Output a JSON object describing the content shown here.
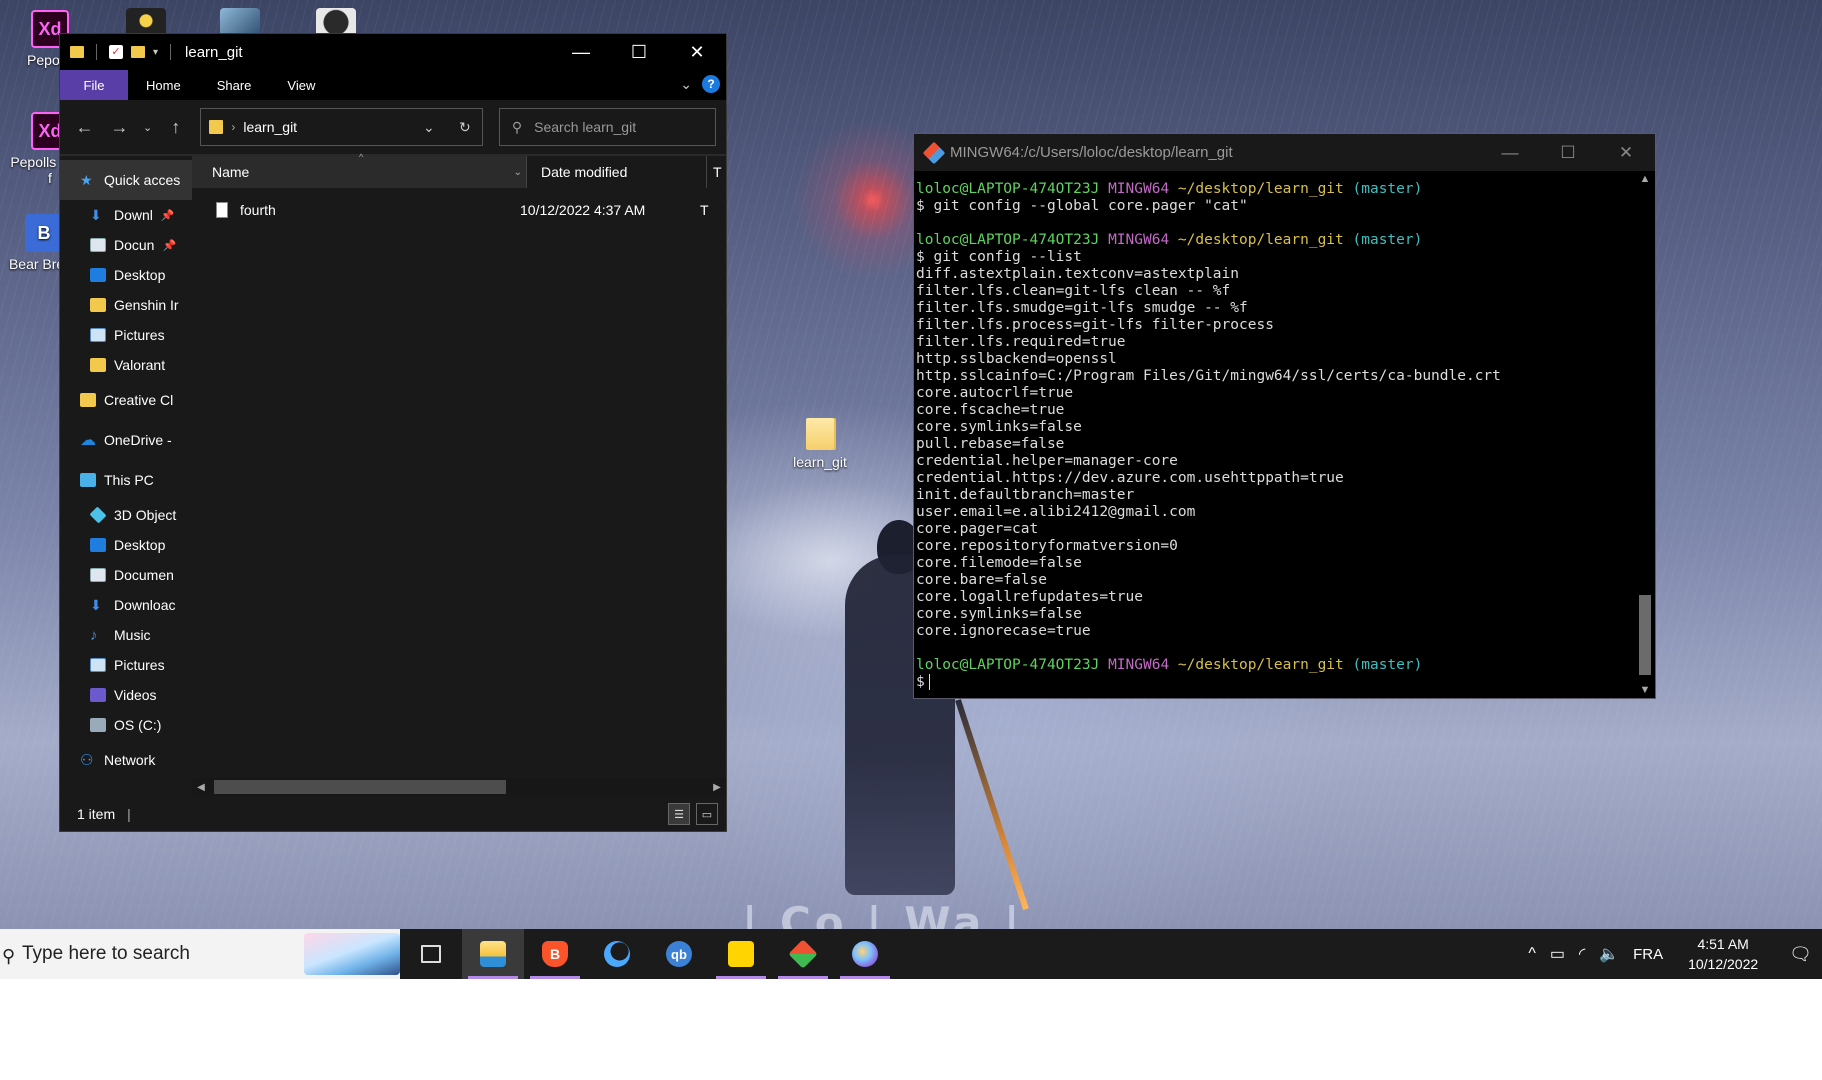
{
  "desktop": {
    "icons": [
      {
        "label": "Pepolls",
        "glyph": "Xd"
      },
      {
        "label": "Pepolls User f",
        "glyph": "Xd"
      },
      {
        "label": "Bear Break",
        "glyph": "B"
      }
    ],
    "folder_label": "learn_git",
    "wallpaper_text": "| Co | Wa |"
  },
  "explorer": {
    "title": "learn_git",
    "ribbon_tabs": [
      "File",
      "Home",
      "Share",
      "View"
    ],
    "address_path": "learn_git",
    "search_placeholder": "Search learn_git",
    "sidebar": [
      {
        "label": "Quick acces",
        "icon": "star-icon",
        "level": "top"
      },
      {
        "label": "Downl",
        "icon": "download-icon",
        "pinned": true
      },
      {
        "label": "Docun",
        "icon": "document-icon",
        "pinned": true
      },
      {
        "label": "Desktop",
        "icon": "desktop-icon"
      },
      {
        "label": "Genshin Ir",
        "icon": "folder-icon"
      },
      {
        "label": "Pictures",
        "icon": "pictures-icon"
      },
      {
        "label": "Valorant",
        "icon": "folder-icon"
      },
      {
        "label": "Creative Cl",
        "icon": "creative-cloud-icon",
        "level": "top"
      },
      {
        "label": "OneDrive -",
        "icon": "onedrive-icon",
        "level": "top"
      },
      {
        "label": "This PC",
        "icon": "this-pc-icon",
        "level": "top"
      },
      {
        "label": "3D Object",
        "icon": "3d-objects-icon"
      },
      {
        "label": "Desktop",
        "icon": "desktop-icon"
      },
      {
        "label": "Documen",
        "icon": "document-icon"
      },
      {
        "label": "Downloac",
        "icon": "download-icon"
      },
      {
        "label": "Music",
        "icon": "music-icon"
      },
      {
        "label": "Pictures",
        "icon": "pictures-icon"
      },
      {
        "label": "Videos",
        "icon": "videos-icon"
      },
      {
        "label": "OS (C:)",
        "icon": "drive-icon"
      },
      {
        "label": "Network",
        "icon": "network-icon",
        "level": "top"
      }
    ],
    "columns": {
      "name": "Name",
      "date": "Date modified",
      "type": "T"
    },
    "files": [
      {
        "name": "fourth",
        "date": "10/12/2022 4:37 AM",
        "type": "T"
      }
    ],
    "status": "1 item"
  },
  "terminal": {
    "title": "MINGW64:/c/Users/loloc/desktop/learn_git",
    "prompt": {
      "user": "loloc@LAPTOP-474OT23J",
      "system": "MINGW64",
      "path": "~/desktop/learn_git",
      "branch": "(master)"
    },
    "cmd1": "$ git config --global core.pager \"cat\"",
    "cmd2": "$ git config --list",
    "output": "diff.astextplain.textconv=astextplain\nfilter.lfs.clean=git-lfs clean -- %f\nfilter.lfs.smudge=git-lfs smudge -- %f\nfilter.lfs.process=git-lfs filter-process\nfilter.lfs.required=true\nhttp.sslbackend=openssl\nhttp.sslcainfo=C:/Program Files/Git/mingw64/ssl/certs/ca-bundle.crt\ncore.autocrlf=true\ncore.fscache=true\ncore.symlinks=false\npull.rebase=false\ncredential.helper=manager-core\ncredential.https://dev.azure.com.usehttppath=true\ninit.defaultbranch=master\nuser.email=e.alibi2412@gmail.com\ncore.pager=cat\ncore.repositoryformatversion=0\ncore.filemode=false\ncore.bare=false\ncore.logallrefupdates=true\ncore.symlinks=false\ncore.ignorecase=true",
    "final_prompt": "$"
  },
  "taskbar": {
    "search_placeholder": "Type here to search",
    "apps": [
      {
        "name": "task-view",
        "active": false,
        "underline": false
      },
      {
        "name": "file-explorer",
        "active": true,
        "underline": true
      },
      {
        "name": "brave",
        "active": false,
        "underline": true,
        "glyph": "B"
      },
      {
        "name": "browser-moon",
        "active": false,
        "underline": false
      },
      {
        "name": "qbittorrent",
        "active": false,
        "underline": false,
        "glyph": "qb"
      },
      {
        "name": "sticky-notes",
        "active": false,
        "underline": true
      },
      {
        "name": "git",
        "active": false,
        "underline": true
      },
      {
        "name": "paint",
        "active": false,
        "underline": true
      }
    ],
    "language": "FRA",
    "time": "4:51 AM",
    "date": "10/12/2022"
  },
  "colors": {
    "ribbon_file_tab": "#5a3ea8",
    "prompt_user": "#5fd35f",
    "prompt_system": "#c26ac6",
    "prompt_path": "#d8c048",
    "prompt_branch": "#3fbfbf",
    "taskbar_accent": "#b48ae8"
  }
}
